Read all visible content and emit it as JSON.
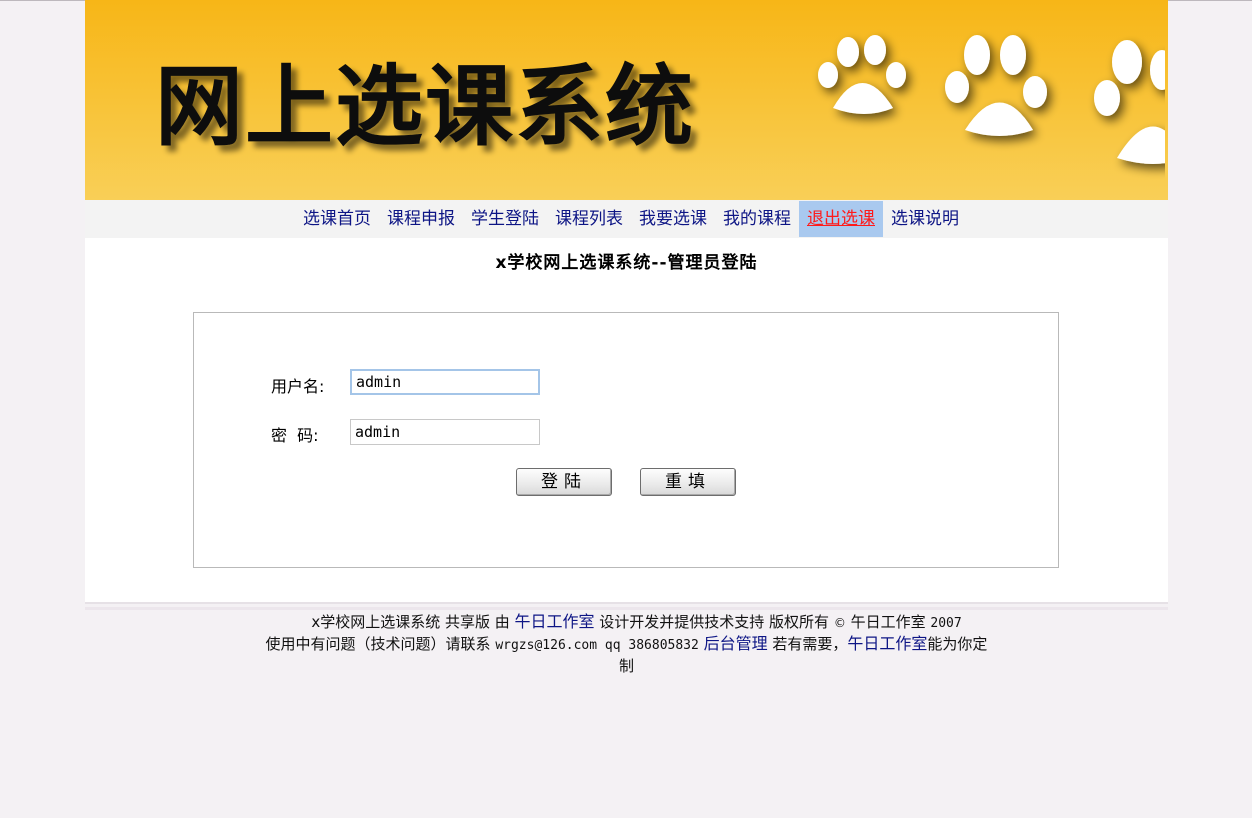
{
  "banner": {
    "title_text": "网上选课系统"
  },
  "nav": {
    "items": [
      {
        "label": "选课首页"
      },
      {
        "label": "课程申报"
      },
      {
        "label": "学生登陆"
      },
      {
        "label": "课程列表"
      },
      {
        "label": "我要选课"
      },
      {
        "label": "我的课程"
      },
      {
        "label": "退出选课",
        "active": true
      },
      {
        "label": "选课说明"
      }
    ]
  },
  "main": {
    "title": "x学校网上选课系统--管理员登陆",
    "username_label": "用户名:",
    "username_value": "admin",
    "password_label": "密  码:",
    "password_value": "admin",
    "login_button": "登陆",
    "reset_button": "重填"
  },
  "footer": {
    "line1_a": "x学校网上选课系统 共享版 由 ",
    "line1_link": "午日工作室",
    "line1_b": " 设计开发并提供技术支持 版权所有 ",
    "copyright_symbol": "©",
    "line1_c": " 午日工作室 ",
    "line1_year": "2007",
    "line2_a": "使用中有问题（技术问题）请联系 ",
    "line2_email": "wrgzs@126.com qq 386805832",
    "line2_admin_link": "后台管理",
    "line2_b": " 若有需要，",
    "line2_link": "午日工作室",
    "line2_c": "能为你定",
    "line3": "制"
  },
  "colors": {
    "banner_yellow": "#f8c43a",
    "nav_link": "#0d1585",
    "nav_active_bg": "#a9c9ef",
    "nav_active_text": "#ff1a1a"
  }
}
